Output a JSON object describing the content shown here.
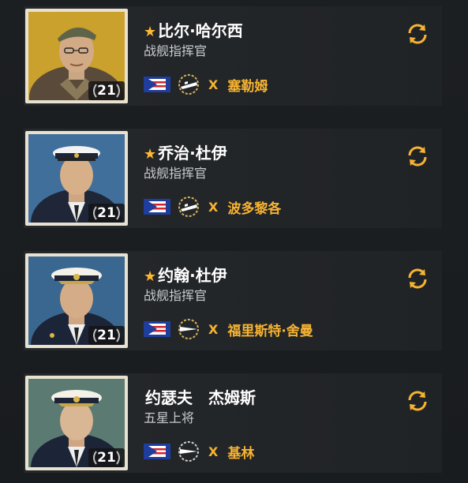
{
  "colors": {
    "accent": "#f7b331",
    "star": "#ffb830",
    "background": "#1b1e21",
    "card": "#24272a",
    "frame": "#e9e1cf"
  },
  "commanders": [
    {
      "name": "比尔·哈尔西",
      "star": "★",
      "rank": "战舰指挥官",
      "level": "21",
      "nation_flag": "pan-america-flag",
      "ship_class_icon": "battleship-elite-icon",
      "tier": "X",
      "ship": "塞勒姆",
      "portrait_bg": "#c9a12c"
    },
    {
      "name": "乔治·杜伊",
      "star": "★",
      "rank": "战舰指挥官",
      "level": "21",
      "nation_flag": "pan-america-flag",
      "ship_class_icon": "battleship-elite-icon",
      "tier": "X",
      "ship": "波多黎各",
      "portrait_bg": "#3f6f9a"
    },
    {
      "name": "约翰·杜伊",
      "star": "★",
      "rank": "战舰指挥官",
      "level": "21",
      "nation_flag": "pan-america-flag",
      "ship_class_icon": "battleship-icon",
      "tier": "X",
      "ship": "福里斯特·舍曼",
      "portrait_bg": "#3a6790"
    },
    {
      "name": "约瑟夫　杰姆斯",
      "star": "",
      "rank": "五星上将",
      "level": "21",
      "nation_flag": "pan-america-flag",
      "ship_class_icon": "battleship-icon",
      "tier": "X",
      "ship": "基林",
      "portrait_bg": "#5b7a72"
    }
  ]
}
